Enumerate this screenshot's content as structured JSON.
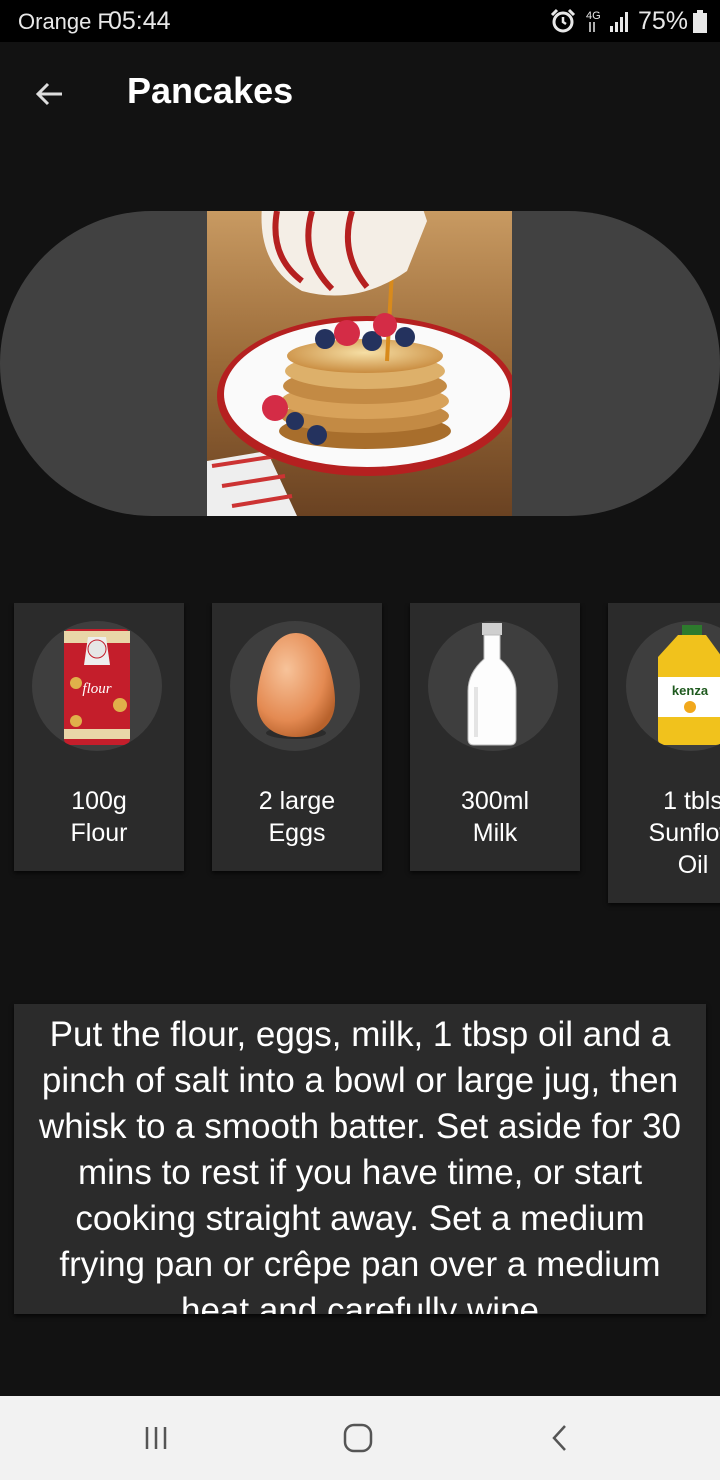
{
  "status_bar": {
    "carrier": "Orange F",
    "time": "05:44",
    "network": "4G",
    "battery_percent": "75%",
    "icons": [
      "alarm-icon",
      "network-signal-icon",
      "battery-icon"
    ]
  },
  "header": {
    "back_icon": "arrow-left-icon",
    "title": "Pancakes"
  },
  "hero": {
    "image": "pancake-stack-with-syrup-photo"
  },
  "ingredients": [
    {
      "amount": "100g",
      "name": "Flour",
      "image": "flour-bag-photo"
    },
    {
      "amount": "2 large",
      "name": "Eggs",
      "image": "egg-photo"
    },
    {
      "amount": "300ml",
      "name": "Milk",
      "image": "milk-bottle-photo"
    },
    {
      "amount": "1 tbls",
      "name": "Sunflow",
      "name_line2": "Oil",
      "image": "sunflower-oil-bottle-photo"
    }
  ],
  "instructions": {
    "text": "Put the flour, eggs, milk, 1 tbsp oil and a pinch of salt into a bowl or large jug, then whisk to a smooth batter. Set aside for 30 mins to rest if you have time, or start cooking straight away. Set a medium frying pan or crêpe pan over a medium heat and carefully wipe"
  },
  "nav_bar": {
    "icons": [
      "recent-apps-icon",
      "home-icon",
      "back-icon"
    ]
  }
}
